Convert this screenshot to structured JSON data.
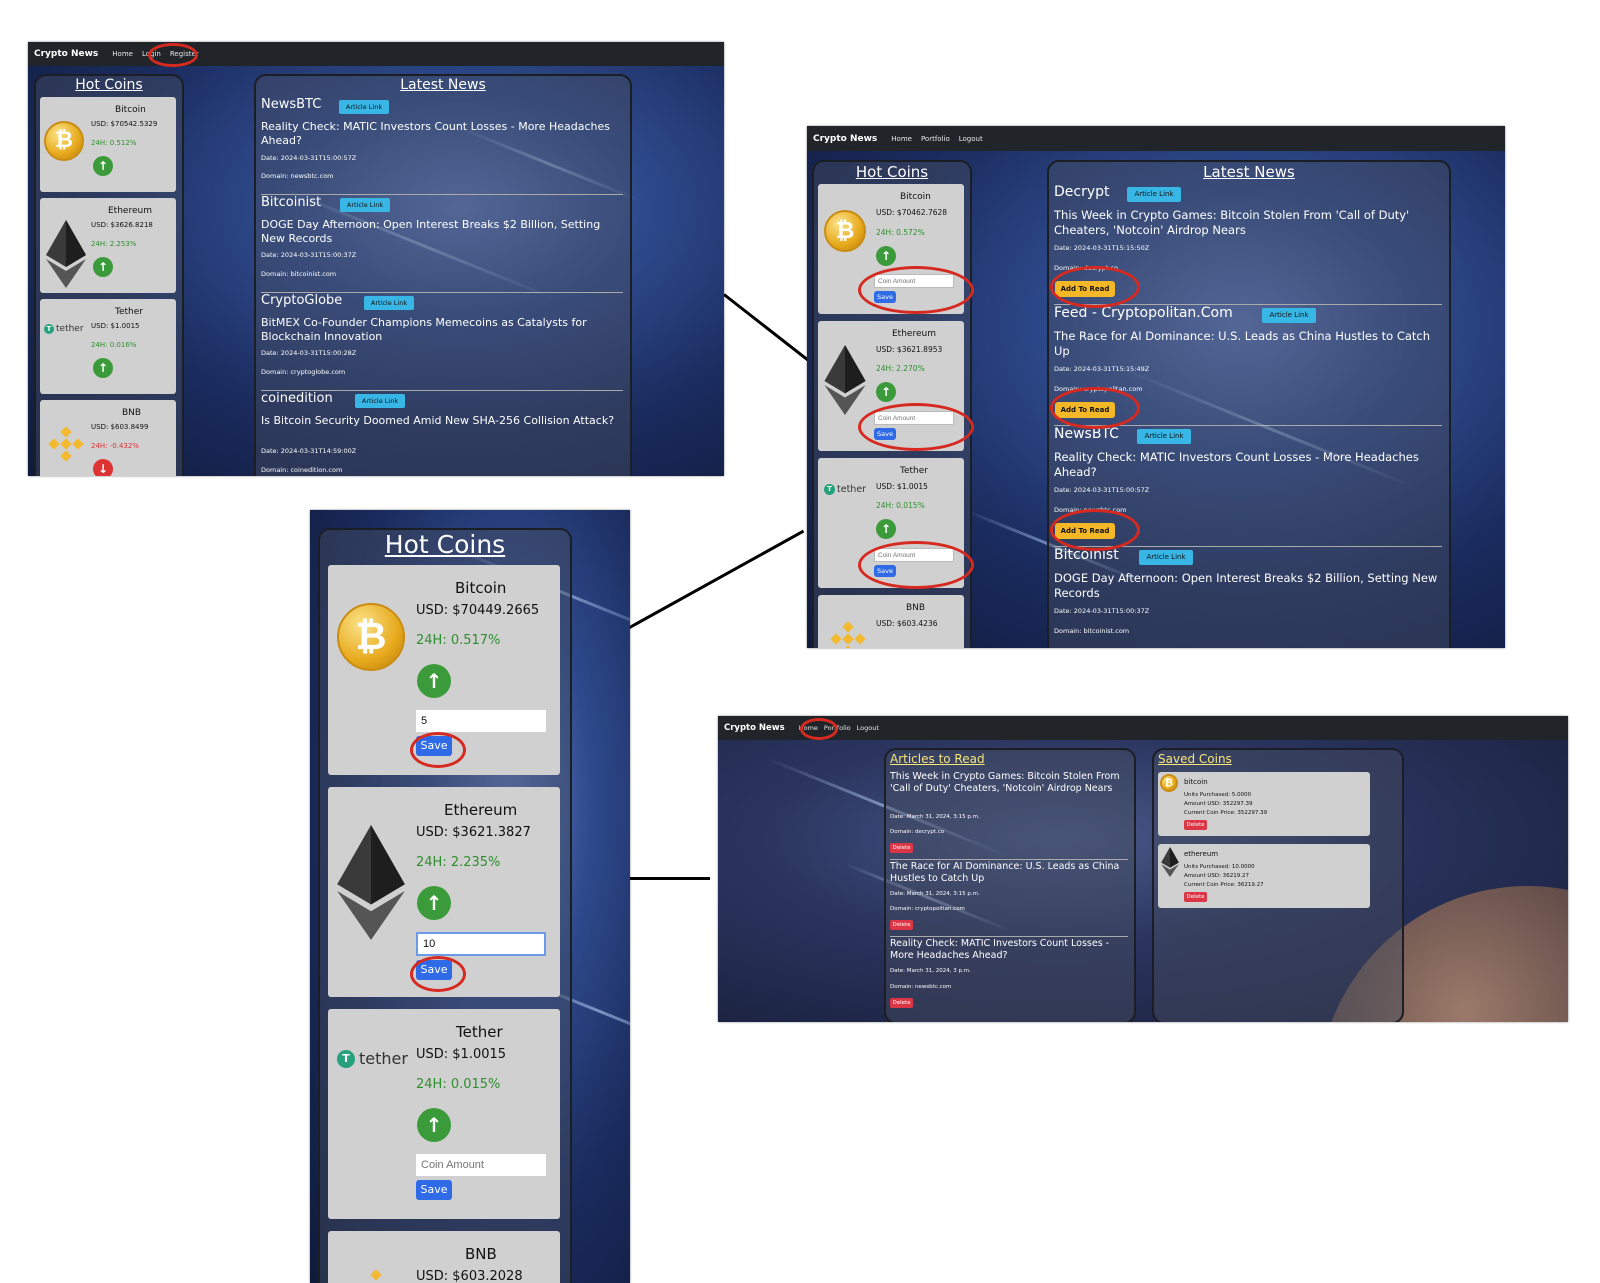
{
  "shot1": {
    "nav": {
      "brand": "Crypto News",
      "home": "Home",
      "login": "Login",
      "register": "Register"
    },
    "hot_title": "Hot Coins",
    "news_title": "Latest News",
    "coins": [
      {
        "name": "Bitcoin",
        "usd": "USD: $70542.5329",
        "pct": "24H: 0.512%"
      },
      {
        "name": "Ethereum",
        "usd": "USD: $3626.8218",
        "pct": "24H: 2.253%"
      },
      {
        "name": "Tether",
        "usd": "USD: $1.0015",
        "pct": "24H: 0.016%"
      },
      {
        "name": "BNB",
        "usd": "USD: $603.8499",
        "pct": "24H: -0.432%"
      }
    ],
    "news": [
      {
        "source": "NewsBTC",
        "badge": "Article Link",
        "title": "Reality Check: MATIC Investors Count Losses - More Headaches Ahead?",
        "date": "Date: 2024-03-31T15:00:57Z",
        "domain": "Domain: newsbtc.com"
      },
      {
        "source": "Bitcoinist",
        "badge": "Article Link",
        "title": "DOGE Day Afternoon: Open Interest Breaks $2 Billion, Setting New Records",
        "date": "Date: 2024-03-31T15:00:37Z",
        "domain": "Domain: bitcoinist.com"
      },
      {
        "source": "CryptoGlobe",
        "badge": "Article Link",
        "title": "BitMEX Co-Founder Champions Memecoins as Catalysts for Blockchain Innovation",
        "date": "Date: 2024-03-31T15:00:28Z",
        "domain": "Domain: cryptoglobe.com"
      },
      {
        "source": "coinedition",
        "badge": "Article Link",
        "title": "Is Bitcoin Security Doomed Amid New SHA-256 Collision Attack?",
        "date": "Date: 2024-03-31T14:59:00Z",
        "domain": "Domain: coinedition.com"
      }
    ]
  },
  "shot2": {
    "nav": {
      "brand": "Crypto News",
      "home": "Home",
      "portfolio": "Portfolio",
      "logout": "Logout"
    },
    "hot_title": "Hot Coins",
    "news_title": "Latest News",
    "coins": [
      {
        "name": "Bitcoin",
        "usd": "USD: $70462.7628",
        "pct": "24H: 0.572%"
      },
      {
        "name": "Ethereum",
        "usd": "USD: $3621.8953",
        "pct": "24H: 2.270%"
      },
      {
        "name": "Tether",
        "usd": "USD: $1.0015",
        "pct": "24H: 0.015%"
      },
      {
        "name": "BNB",
        "usd": "USD: $603.4236"
      }
    ],
    "placeholder": "Coin Amount",
    "save": "Save",
    "read_btn": "Add To Read",
    "news": [
      {
        "source": "Decrypt",
        "badge": "Article Link",
        "title": "This Week in Crypto Games: Bitcoin Stolen From 'Call of Duty' Cheaters, 'Notcoin' Airdrop Nears",
        "date": "Date: 2024-03-31T15:15:50Z",
        "domain": "Domain: decrypt.co"
      },
      {
        "source": "Feed - Cryptopolitan.Com",
        "badge": "Article Link",
        "title": "The Race for AI Dominance: U.S. Leads as China Hustles to Catch Up",
        "date": "Date: 2024-03-31T15:15:49Z",
        "domain": "Domain: cryptopolitan.com"
      },
      {
        "source": "NewsBTC",
        "badge": "Article Link",
        "title": "Reality Check: MATIC Investors Count Losses - More Headaches Ahead?",
        "date": "Date: 2024-03-31T15:00:57Z",
        "domain": "Domain: newsbtc.com"
      },
      {
        "source": "Bitcoinist",
        "badge": "Article Link",
        "title": "DOGE Day Afternoon: Open Interest Breaks $2 Billion, Setting New Records",
        "date": "Date: 2024-03-31T15:00:37Z",
        "domain": "Domain: bitcoinist.com"
      }
    ]
  },
  "shot3": {
    "hot_title": "Hot Coins",
    "coins": [
      {
        "name": "Bitcoin",
        "usd": "USD: $70449.2665",
        "pct": "24H: 0.517%",
        "amount": "5"
      },
      {
        "name": "Ethereum",
        "usd": "USD: $3621.3827",
        "pct": "24H: 2.235%",
        "amount": "10"
      },
      {
        "name": "Tether",
        "usd": "USD: $1.0015",
        "pct": "24H: 0.015%"
      },
      {
        "name": "BNB",
        "usd": "USD: $603.2028"
      }
    ],
    "placeholder": "Coin Amount",
    "save": "Save",
    "tether_word": "tether"
  },
  "shot4": {
    "nav": {
      "brand": "Crypto News",
      "home": "Home",
      "portfolio": "Portfolio",
      "logout": "Logout"
    },
    "articles_title": "Articles to Read",
    "coins_title": "Saved Coins",
    "delete": "Delete",
    "articles": [
      {
        "title": "This Week in Crypto Games: Bitcoin Stolen From 'Call of Duty' Cheaters, 'Notcoin' Airdrop Nears",
        "date": "Date: March 31, 2024, 3:15 p.m.",
        "domain": "Domain: decrypt.co"
      },
      {
        "title": "The Race for AI Dominance: U.S. Leads as China Hustles to Catch Up",
        "date": "Date: March 31, 2024, 3:15 p.m.",
        "domain": "Domain: cryptopolitan.com"
      },
      {
        "title": "Reality Check: MATIC Investors Count Losses - More Headaches Ahead?",
        "date": "Date: March 31, 2024, 3 p.m.",
        "domain": "Domain: newsbtc.com"
      }
    ],
    "saved": [
      {
        "name": "bitcoin",
        "units": "Units Purchased: 5.0000",
        "amount": "Amount USD: 352297.39",
        "price": "Current Coin Price: 352297.39"
      },
      {
        "name": "ethereum",
        "units": "Units Purchased: 10.0000",
        "amount": "Amount USD: 36219.27",
        "price": "Current Coin Price: 36219.27"
      }
    ]
  }
}
